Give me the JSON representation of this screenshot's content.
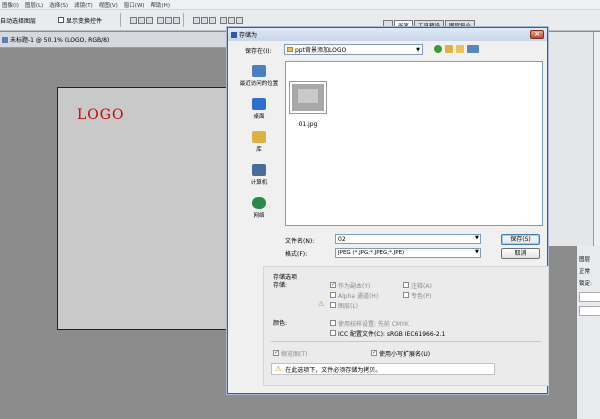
{
  "menubar": {
    "items": [
      "图像(I)",
      "图层(L)",
      "选择(S)",
      "滤镜(T)",
      "视图(V)",
      "窗口(W)",
      "帮助(H)"
    ]
  },
  "options_bar": {
    "auto_select_layer_label": "自动选择图层",
    "show_transform_label": "显示变换控件"
  },
  "panel_tabs": [
    "画笔",
    "工具预设",
    "图层复合"
  ],
  "document": {
    "title": "未标题-1 @ 50.1% (LOGO, RGB/8)",
    "logo_text": "LOGO"
  },
  "layers_panel": {
    "tab": "图层",
    "blend_mode": "正常",
    "lock_label": "锁定:"
  },
  "dialog": {
    "title": "存储为",
    "save_in_label": "保存在(I):",
    "save_in_value": "ppt背景添加LOGO",
    "places": [
      {
        "label": "最近访问的位置",
        "color": "#4a7fc0"
      },
      {
        "label": "桌面",
        "color": "#2f6fd0"
      },
      {
        "label": "库",
        "color": "#e0b040"
      },
      {
        "label": "计算机",
        "color": "#4a6a9a"
      },
      {
        "label": "网络",
        "color": "#2a8a4a"
      }
    ],
    "files": [
      {
        "name": "01.jpg"
      }
    ],
    "filename_label": "文件名(N):",
    "filename_value": "02",
    "format_label": "格式(F):",
    "format_value": "JPEG (*.JPG;*.JPEG;*.JPE)",
    "save_button": "保存(S)",
    "cancel_button": "取消",
    "options": {
      "section_title": "存储选项",
      "store_label": "存储:",
      "as_copy": "作为副本(Y)",
      "notes": "注释(A)",
      "alpha": "Alpha 通道(H)",
      "spot": "专色(P)",
      "layers": "图层(L)",
      "color_label": "颜色:",
      "use_proof": "使用校样设置: 先前 CMYK",
      "icc_profile": "ICC 配置文件(C): sRGB IEC61966-2.1",
      "thumbnail": "缩览图(T)",
      "lowercase_ext": "使用小写扩展名(U)",
      "warning": "在此选项下，文件必须存储为拷贝。"
    }
  }
}
